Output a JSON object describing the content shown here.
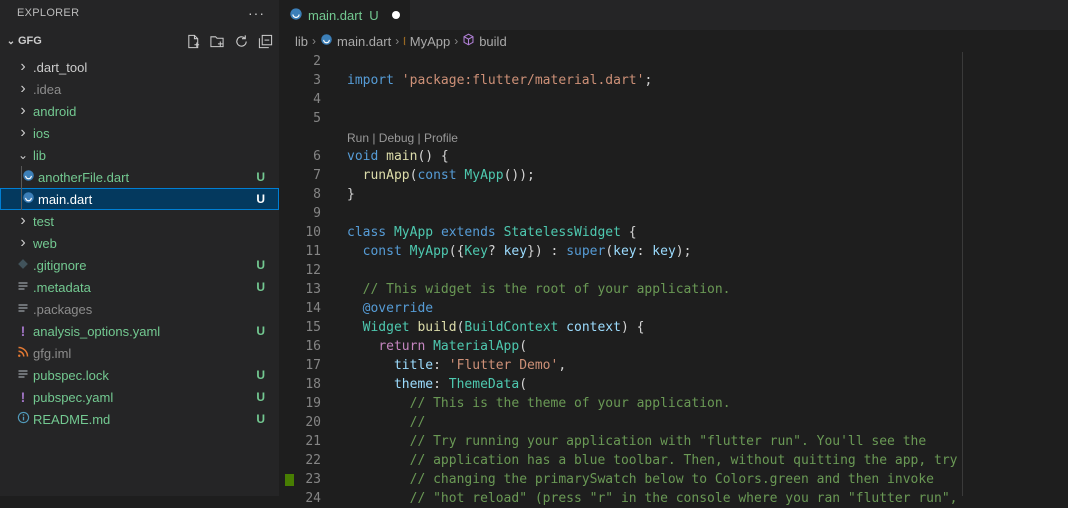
{
  "explorer": {
    "title": "EXPLORER",
    "more": "···",
    "folder": "GFG",
    "items": [
      {
        "label": ".dart_tool",
        "kind": "folder",
        "indent": 0,
        "color": "#cccccc",
        "deco": ""
      },
      {
        "label": ".idea",
        "kind": "folder",
        "indent": 0,
        "color": "#8c8c8c",
        "deco": ""
      },
      {
        "label": "android",
        "kind": "folder",
        "indent": 0,
        "color": "#73c991",
        "deco": "dot"
      },
      {
        "label": "ios",
        "kind": "folder",
        "indent": 0,
        "color": "#73c991",
        "deco": "dot"
      },
      {
        "label": "lib",
        "kind": "folder-open",
        "indent": 0,
        "color": "#73c991",
        "deco": "dot"
      },
      {
        "label": "anotherFile.dart",
        "kind": "dart",
        "indent": 1,
        "color": "#73c991",
        "deco": "U"
      },
      {
        "label": "main.dart",
        "kind": "dart",
        "indent": 1,
        "color": "#ffffff",
        "deco": "U",
        "selected": true
      },
      {
        "label": "test",
        "kind": "folder",
        "indent": 0,
        "color": "#73c991",
        "deco": "dot"
      },
      {
        "label": "web",
        "kind": "folder",
        "indent": 0,
        "color": "#73c991",
        "deco": "dot"
      },
      {
        "label": ".gitignore",
        "kind": "git",
        "indent": 0,
        "color": "#73c991",
        "deco": "U"
      },
      {
        "label": ".metadata",
        "kind": "lines",
        "indent": 0,
        "color": "#73c991",
        "deco": "U"
      },
      {
        "label": ".packages",
        "kind": "lines",
        "indent": 0,
        "color": "#8c8c8c",
        "deco": ""
      },
      {
        "label": "analysis_options.yaml",
        "kind": "yaml",
        "indent": 0,
        "color": "#73c991",
        "deco": "U"
      },
      {
        "label": "gfg.iml",
        "kind": "rss",
        "indent": 0,
        "color": "#8c8c8c",
        "deco": ""
      },
      {
        "label": "pubspec.lock",
        "kind": "lines",
        "indent": 0,
        "color": "#73c991",
        "deco": "U"
      },
      {
        "label": "pubspec.yaml",
        "kind": "yaml",
        "indent": 0,
        "color": "#73c991",
        "deco": "U"
      },
      {
        "label": "README.md",
        "kind": "info",
        "indent": 0,
        "color": "#73c991",
        "deco": "U"
      }
    ]
  },
  "tab": {
    "label": "main.dart",
    "status": "U"
  },
  "breadcrumb": [
    "lib",
    "main.dart",
    "MyApp",
    "build"
  ],
  "codelens": "Run | Debug | Profile",
  "code": [
    {
      "n": "2",
      "t": []
    },
    {
      "n": "3",
      "t": [
        [
          "kw",
          "import "
        ],
        [
          "str",
          "'package:flutter/material.dart'"
        ],
        [
          "plain",
          ";"
        ]
      ]
    },
    {
      "n": "4",
      "t": []
    },
    {
      "n": "5",
      "t": []
    },
    {
      "lens": true
    },
    {
      "n": "6",
      "t": [
        [
          "kw",
          "void "
        ],
        [
          "fn",
          "main"
        ],
        [
          "plain",
          "() {"
        ]
      ]
    },
    {
      "n": "7",
      "t": [
        [
          "plain",
          "  "
        ],
        [
          "fn",
          "runApp"
        ],
        [
          "plain",
          "("
        ],
        [
          "kw",
          "const "
        ],
        [
          "cls",
          "MyApp"
        ],
        [
          "plain",
          "());"
        ]
      ]
    },
    {
      "n": "8",
      "t": [
        [
          "plain",
          "}"
        ]
      ]
    },
    {
      "n": "9",
      "t": []
    },
    {
      "n": "10",
      "t": [
        [
          "kw",
          "class "
        ],
        [
          "cls",
          "MyApp "
        ],
        [
          "kw",
          "extends "
        ],
        [
          "cls",
          "StatelessWidget"
        ],
        [
          "plain",
          " {"
        ]
      ]
    },
    {
      "n": "11",
      "t": [
        [
          "plain",
          "  "
        ],
        [
          "kw",
          "const "
        ],
        [
          "cls",
          "MyApp"
        ],
        [
          "plain",
          "({"
        ],
        [
          "cls",
          "Key"
        ],
        [
          "plain",
          "? "
        ],
        [
          "var",
          "key"
        ],
        [
          "plain",
          "}) : "
        ],
        [
          "kw",
          "super"
        ],
        [
          "plain",
          "("
        ],
        [
          "var",
          "key"
        ],
        [
          "plain",
          ": "
        ],
        [
          "var",
          "key"
        ],
        [
          "plain",
          ");"
        ]
      ]
    },
    {
      "n": "12",
      "t": []
    },
    {
      "n": "13",
      "t": [
        [
          "plain",
          "  "
        ],
        [
          "cm",
          "// This widget is the root of your application."
        ]
      ]
    },
    {
      "n": "14",
      "t": [
        [
          "plain",
          "  "
        ],
        [
          "kw",
          "@override"
        ]
      ]
    },
    {
      "n": "15",
      "t": [
        [
          "plain",
          "  "
        ],
        [
          "cls",
          "Widget "
        ],
        [
          "fn",
          "build"
        ],
        [
          "plain",
          "("
        ],
        [
          "cls",
          "BuildContext "
        ],
        [
          "var",
          "context"
        ],
        [
          "plain",
          ") {"
        ]
      ]
    },
    {
      "n": "16",
      "t": [
        [
          "plain",
          "    "
        ],
        [
          "ctl",
          "return "
        ],
        [
          "cls",
          "MaterialApp"
        ],
        [
          "plain",
          "("
        ]
      ]
    },
    {
      "n": "17",
      "t": [
        [
          "plain",
          "      "
        ],
        [
          "var",
          "title"
        ],
        [
          "plain",
          ": "
        ],
        [
          "str",
          "'Flutter Demo'"
        ],
        [
          "plain",
          ","
        ]
      ]
    },
    {
      "n": "18",
      "t": [
        [
          "plain",
          "      "
        ],
        [
          "var",
          "theme"
        ],
        [
          "plain",
          ": "
        ],
        [
          "cls",
          "ThemeData"
        ],
        [
          "plain",
          "("
        ]
      ]
    },
    {
      "n": "19",
      "t": [
        [
          "plain",
          "        "
        ],
        [
          "cm",
          "// This is the theme of your application."
        ]
      ]
    },
    {
      "n": "20",
      "t": [
        [
          "plain",
          "        "
        ],
        [
          "cm",
          "//"
        ]
      ]
    },
    {
      "n": "21",
      "t": [
        [
          "plain",
          "        "
        ],
        [
          "cm",
          "// Try running your application with \"flutter run\". You'll see the"
        ]
      ]
    },
    {
      "n": "22",
      "t": [
        [
          "plain",
          "        "
        ],
        [
          "cm",
          "// application has a blue toolbar. Then, without quitting the app, try"
        ]
      ]
    },
    {
      "n": "23",
      "t": [
        [
          "plain",
          "        "
        ],
        [
          "cm",
          "// changing the primarySwatch below to Colors.green and then invoke"
        ]
      ],
      "mark": true
    },
    {
      "n": "24",
      "t": [
        [
          "plain",
          "        "
        ],
        [
          "cm",
          "// \"hot reload\" (press \"r\" in the console where you ran \"flutter run\","
        ]
      ]
    }
  ]
}
